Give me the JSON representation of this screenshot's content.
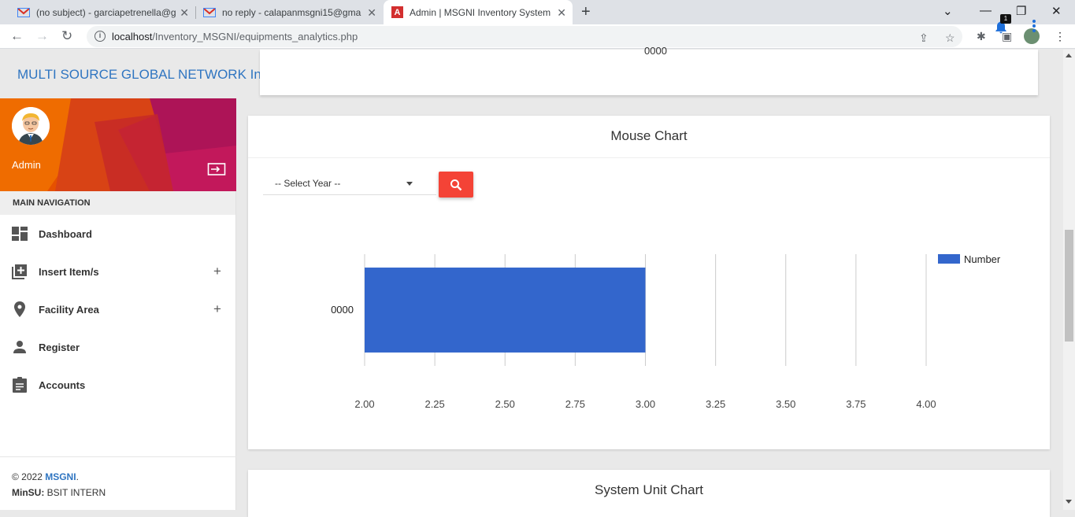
{
  "browser": {
    "tabs": [
      {
        "title": "(no subject) - garciapetrenella@g",
        "favicon": "gmail-icon"
      },
      {
        "title": "no reply - calapanmsgni15@gma",
        "favicon": "gmail-icon"
      },
      {
        "title": "Admin | MSGNI Inventory System",
        "favicon": "app-icon",
        "active": true
      }
    ],
    "url_host": "localhost",
    "url_path": "/Inventory_MSGNI/equipments_analytics.php"
  },
  "header": {
    "brand": "MULTI SOURCE GLOBAL NETWORK Inc.",
    "notification_count": "1"
  },
  "top_card": {
    "tick_label": "0000"
  },
  "sidebar": {
    "user_name": "Admin",
    "nav_header": "MAIN NAVIGATION",
    "items": [
      {
        "label": "Dashboard",
        "icon": "dashboard-icon"
      },
      {
        "label": "Insert Item/s",
        "icon": "library-add-icon",
        "expandable": true
      },
      {
        "label": "Facility Area",
        "icon": "location-pin-icon",
        "expandable": true
      },
      {
        "label": "Register",
        "icon": "person-icon"
      },
      {
        "label": "Accounts",
        "icon": "assignment-icon"
      }
    ],
    "footer": {
      "copyright": "© 2022 ",
      "brand": "MSGNI",
      "period": ".",
      "org_label": "MinSU:",
      "org_value": " BSIT INTERN"
    }
  },
  "mouse_chart": {
    "title": "Mouse Chart",
    "select_placeholder": "-- Select Year --"
  },
  "system_unit_chart": {
    "title": "System Unit Chart"
  },
  "colors": {
    "accent": "#2f75c1",
    "search_button": "#f44336",
    "bar": "#3366cc"
  },
  "chart_data": {
    "type": "bar",
    "orientation": "horizontal",
    "categories": [
      "0000"
    ],
    "series": [
      {
        "name": "Number",
        "values": [
          3
        ]
      }
    ],
    "xlim": [
      2.0,
      4.0
    ],
    "xticks": [
      "2.00",
      "2.25",
      "2.50",
      "2.75",
      "3.00",
      "3.25",
      "3.50",
      "3.75",
      "4.00"
    ],
    "grid": true,
    "legend_position": "right"
  }
}
